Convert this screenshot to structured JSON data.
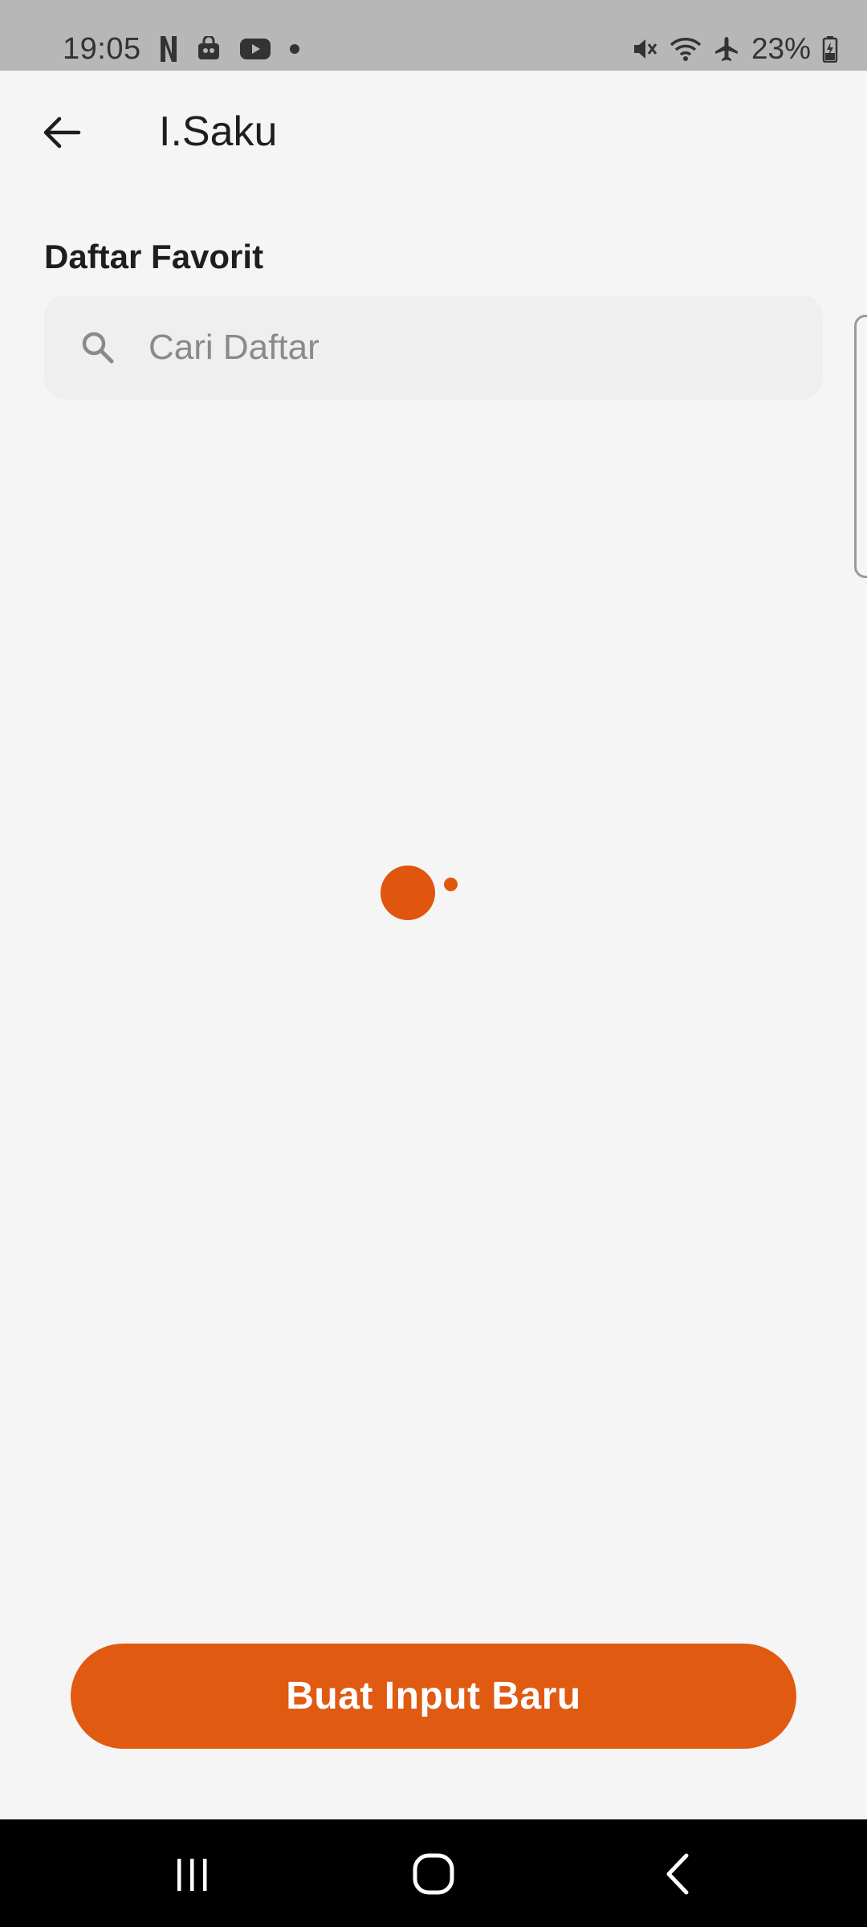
{
  "status_bar": {
    "time": "19:05",
    "battery": "23%",
    "left_icons": [
      "netflix-icon",
      "shopping-bag-icon",
      "youtube-icon",
      "notification-dot-icon"
    ],
    "right_icons": [
      "vibrate-mute-icon",
      "wifi-icon",
      "airplane-icon",
      "battery-charging-icon"
    ]
  },
  "app_bar": {
    "back_icon": "arrow-left-icon",
    "title": "I.Saku"
  },
  "favorites": {
    "section_title": "Daftar Favorit",
    "search_placeholder": "Cari Daftar",
    "search_value": ""
  },
  "loading": {
    "indicator_color": "#e0560e"
  },
  "actions": {
    "primary_label": "Buat Input Baru",
    "primary_color": "#e05a12"
  },
  "nav_bar": {
    "items": [
      "recent-apps-icon",
      "home-icon",
      "back-icon"
    ]
  }
}
